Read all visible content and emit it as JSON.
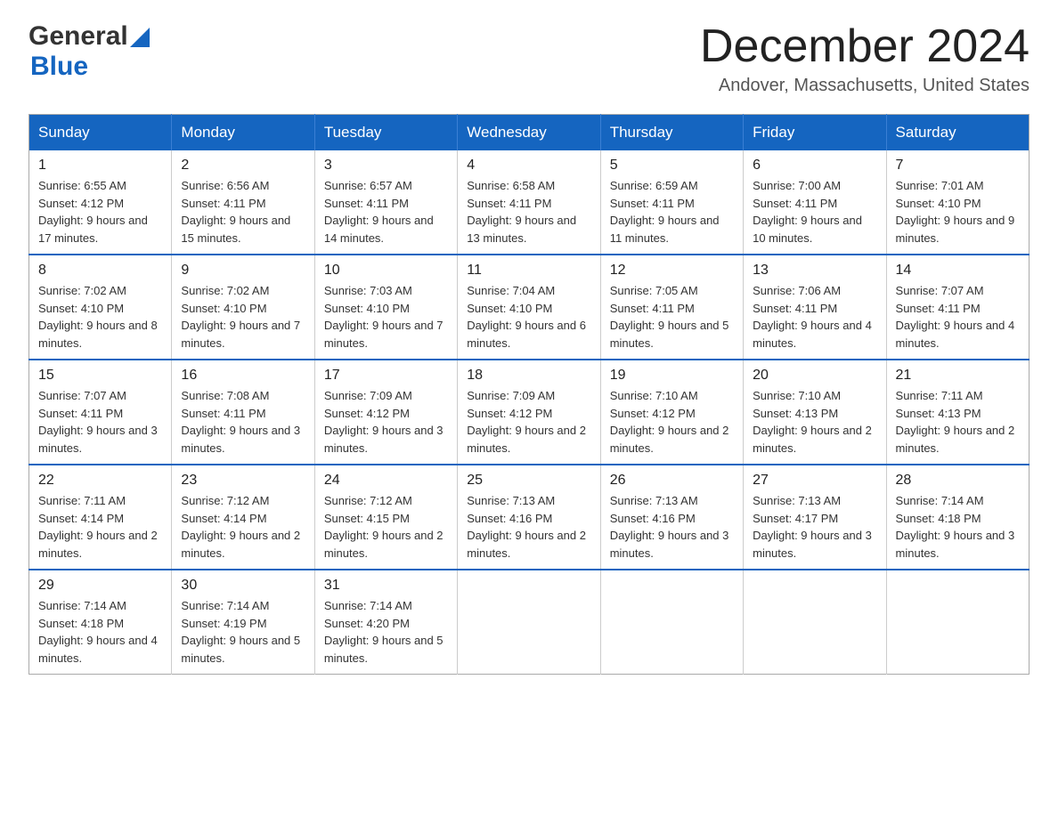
{
  "header": {
    "logo_general": "General",
    "logo_blue": "Blue",
    "month_title": "December 2024",
    "location": "Andover, Massachusetts, United States"
  },
  "days_of_week": [
    "Sunday",
    "Monday",
    "Tuesday",
    "Wednesday",
    "Thursday",
    "Friday",
    "Saturday"
  ],
  "weeks": [
    [
      {
        "day": "1",
        "sunrise": "Sunrise: 6:55 AM",
        "sunset": "Sunset: 4:12 PM",
        "daylight": "Daylight: 9 hours and 17 minutes."
      },
      {
        "day": "2",
        "sunrise": "Sunrise: 6:56 AM",
        "sunset": "Sunset: 4:11 PM",
        "daylight": "Daylight: 9 hours and 15 minutes."
      },
      {
        "day": "3",
        "sunrise": "Sunrise: 6:57 AM",
        "sunset": "Sunset: 4:11 PM",
        "daylight": "Daylight: 9 hours and 14 minutes."
      },
      {
        "day": "4",
        "sunrise": "Sunrise: 6:58 AM",
        "sunset": "Sunset: 4:11 PM",
        "daylight": "Daylight: 9 hours and 13 minutes."
      },
      {
        "day": "5",
        "sunrise": "Sunrise: 6:59 AM",
        "sunset": "Sunset: 4:11 PM",
        "daylight": "Daylight: 9 hours and 11 minutes."
      },
      {
        "day": "6",
        "sunrise": "Sunrise: 7:00 AM",
        "sunset": "Sunset: 4:11 PM",
        "daylight": "Daylight: 9 hours and 10 minutes."
      },
      {
        "day": "7",
        "sunrise": "Sunrise: 7:01 AM",
        "sunset": "Sunset: 4:10 PM",
        "daylight": "Daylight: 9 hours and 9 minutes."
      }
    ],
    [
      {
        "day": "8",
        "sunrise": "Sunrise: 7:02 AM",
        "sunset": "Sunset: 4:10 PM",
        "daylight": "Daylight: 9 hours and 8 minutes."
      },
      {
        "day": "9",
        "sunrise": "Sunrise: 7:02 AM",
        "sunset": "Sunset: 4:10 PM",
        "daylight": "Daylight: 9 hours and 7 minutes."
      },
      {
        "day": "10",
        "sunrise": "Sunrise: 7:03 AM",
        "sunset": "Sunset: 4:10 PM",
        "daylight": "Daylight: 9 hours and 7 minutes."
      },
      {
        "day": "11",
        "sunrise": "Sunrise: 7:04 AM",
        "sunset": "Sunset: 4:10 PM",
        "daylight": "Daylight: 9 hours and 6 minutes."
      },
      {
        "day": "12",
        "sunrise": "Sunrise: 7:05 AM",
        "sunset": "Sunset: 4:11 PM",
        "daylight": "Daylight: 9 hours and 5 minutes."
      },
      {
        "day": "13",
        "sunrise": "Sunrise: 7:06 AM",
        "sunset": "Sunset: 4:11 PM",
        "daylight": "Daylight: 9 hours and 4 minutes."
      },
      {
        "day": "14",
        "sunrise": "Sunrise: 7:07 AM",
        "sunset": "Sunset: 4:11 PM",
        "daylight": "Daylight: 9 hours and 4 minutes."
      }
    ],
    [
      {
        "day": "15",
        "sunrise": "Sunrise: 7:07 AM",
        "sunset": "Sunset: 4:11 PM",
        "daylight": "Daylight: 9 hours and 3 minutes."
      },
      {
        "day": "16",
        "sunrise": "Sunrise: 7:08 AM",
        "sunset": "Sunset: 4:11 PM",
        "daylight": "Daylight: 9 hours and 3 minutes."
      },
      {
        "day": "17",
        "sunrise": "Sunrise: 7:09 AM",
        "sunset": "Sunset: 4:12 PM",
        "daylight": "Daylight: 9 hours and 3 minutes."
      },
      {
        "day": "18",
        "sunrise": "Sunrise: 7:09 AM",
        "sunset": "Sunset: 4:12 PM",
        "daylight": "Daylight: 9 hours and 2 minutes."
      },
      {
        "day": "19",
        "sunrise": "Sunrise: 7:10 AM",
        "sunset": "Sunset: 4:12 PM",
        "daylight": "Daylight: 9 hours and 2 minutes."
      },
      {
        "day": "20",
        "sunrise": "Sunrise: 7:10 AM",
        "sunset": "Sunset: 4:13 PM",
        "daylight": "Daylight: 9 hours and 2 minutes."
      },
      {
        "day": "21",
        "sunrise": "Sunrise: 7:11 AM",
        "sunset": "Sunset: 4:13 PM",
        "daylight": "Daylight: 9 hours and 2 minutes."
      }
    ],
    [
      {
        "day": "22",
        "sunrise": "Sunrise: 7:11 AM",
        "sunset": "Sunset: 4:14 PM",
        "daylight": "Daylight: 9 hours and 2 minutes."
      },
      {
        "day": "23",
        "sunrise": "Sunrise: 7:12 AM",
        "sunset": "Sunset: 4:14 PM",
        "daylight": "Daylight: 9 hours and 2 minutes."
      },
      {
        "day": "24",
        "sunrise": "Sunrise: 7:12 AM",
        "sunset": "Sunset: 4:15 PM",
        "daylight": "Daylight: 9 hours and 2 minutes."
      },
      {
        "day": "25",
        "sunrise": "Sunrise: 7:13 AM",
        "sunset": "Sunset: 4:16 PM",
        "daylight": "Daylight: 9 hours and 2 minutes."
      },
      {
        "day": "26",
        "sunrise": "Sunrise: 7:13 AM",
        "sunset": "Sunset: 4:16 PM",
        "daylight": "Daylight: 9 hours and 3 minutes."
      },
      {
        "day": "27",
        "sunrise": "Sunrise: 7:13 AM",
        "sunset": "Sunset: 4:17 PM",
        "daylight": "Daylight: 9 hours and 3 minutes."
      },
      {
        "day": "28",
        "sunrise": "Sunrise: 7:14 AM",
        "sunset": "Sunset: 4:18 PM",
        "daylight": "Daylight: 9 hours and 3 minutes."
      }
    ],
    [
      {
        "day": "29",
        "sunrise": "Sunrise: 7:14 AM",
        "sunset": "Sunset: 4:18 PM",
        "daylight": "Daylight: 9 hours and 4 minutes."
      },
      {
        "day": "30",
        "sunrise": "Sunrise: 7:14 AM",
        "sunset": "Sunset: 4:19 PM",
        "daylight": "Daylight: 9 hours and 5 minutes."
      },
      {
        "day": "31",
        "sunrise": "Sunrise: 7:14 AM",
        "sunset": "Sunset: 4:20 PM",
        "daylight": "Daylight: 9 hours and 5 minutes."
      },
      null,
      null,
      null,
      null
    ]
  ]
}
